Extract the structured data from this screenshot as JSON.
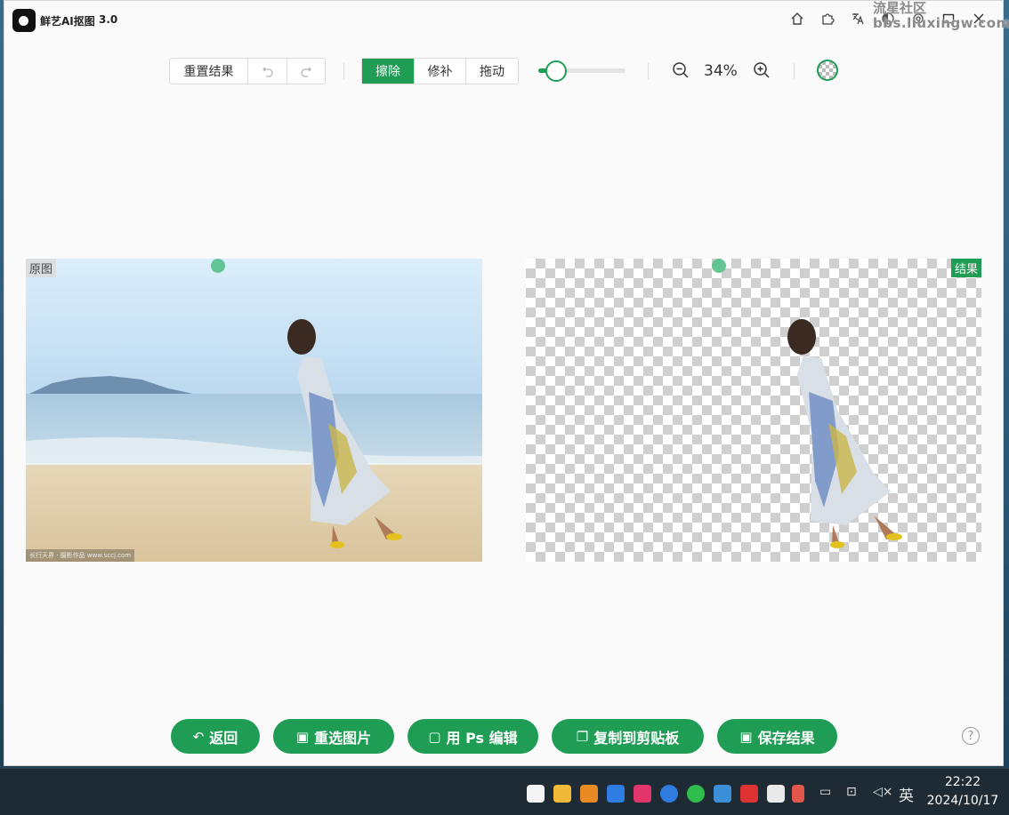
{
  "app": {
    "title": "鲜艺AI抠图",
    "version": "3.0"
  },
  "watermark": {
    "line1": "流星社区",
    "line2": "bbs.liuxingw.com"
  },
  "titlebar_icons": [
    "home-icon",
    "puzzle-icon",
    "translate-icon",
    "theme-icon",
    "settings-icon",
    "maximize-icon",
    "close-icon"
  ],
  "toolbar": {
    "reset_label": "重置结果",
    "undo_icon": "undo-icon",
    "redo_icon": "redo-icon",
    "modes": [
      "擦除",
      "修补",
      "拖动"
    ],
    "active_mode": "擦除",
    "brush_size_fraction": 0.2,
    "zoom_out_icon": "zoom-out-icon",
    "zoom_level": "34%",
    "zoom_in_icon": "zoom-in-icon",
    "background_toggle_icon": "transparent-bg-icon"
  },
  "panels": {
    "original_label": "原图",
    "result_label": "结果",
    "original_caption": "长行天界 · 摄影作品 www.sccj.com"
  },
  "actions": [
    {
      "label": "返回",
      "icon": "back-icon"
    },
    {
      "label": "重选图片",
      "icon": "image-add-icon"
    },
    {
      "label": "用 Ps 编辑",
      "icon": "photoshop-icon"
    },
    {
      "label": "复制到剪贴板",
      "icon": "copy-icon"
    },
    {
      "label": "保存结果",
      "icon": "save-image-icon"
    }
  ],
  "taskbar": {
    "ime": "英",
    "time": "22:22",
    "date": "2024/10/17"
  },
  "colors": {
    "accent": "#1f9d55",
    "window_bg": "#fafafa",
    "taskbar_bg": "#1f2b34"
  }
}
